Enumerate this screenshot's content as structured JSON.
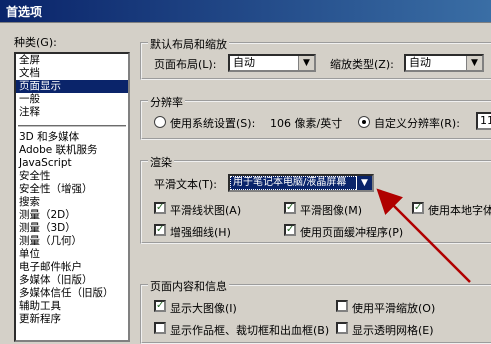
{
  "window": {
    "title": "首选项"
  },
  "categories": {
    "label": "种类(G):",
    "items": [
      "全屏",
      "文档",
      "页面显示",
      "一般",
      "注释"
    ],
    "items2": [
      "3D 和多媒体",
      "Adobe 联机服务",
      "JavaScript",
      "安全性",
      "安全性（增强）",
      "搜索",
      "测量（2D）",
      "测量（3D）",
      "测量（几何）",
      "单位",
      "电子邮件帐户",
      "多媒体（旧版）",
      "多媒体信任（旧版）",
      "辅助工具",
      "更新程序"
    ],
    "selected": "页面显示"
  },
  "default_layout": {
    "legend": "默认布局和缩放",
    "layout_label": "页面布局(L):",
    "layout_value": "自动",
    "zoom_label": "缩放类型(Z):",
    "zoom_value": "自动"
  },
  "resolution": {
    "legend": "分辨率",
    "system_label": "使用系统设置(S):",
    "system_value": "106 像素/英寸",
    "custom_label": "自定义分辨率(R):",
    "custom_value": "11"
  },
  "rendering": {
    "legend": "渲染",
    "smooth_label": "平滑文本(T):",
    "smooth_value": "用于笔记本电脑/液晶屏幕",
    "checks": [
      {
        "label": "平滑线状图(A)",
        "checked": true
      },
      {
        "label": "平滑图像(M)",
        "checked": true
      },
      {
        "label": "使用本地字体(L)",
        "checked": true
      },
      {
        "label": "增强细线(H)",
        "checked": true
      },
      {
        "label": "使用页面缓冲程序(P)",
        "checked": true
      }
    ]
  },
  "page_content": {
    "legend": "页面内容和信息",
    "checks": [
      {
        "label": "显示大图像(I)",
        "checked": true
      },
      {
        "label": "使用平滑缩放(O)",
        "checked": false
      },
      {
        "label": "显示作品框、裁切框和出血框(B)",
        "checked": false
      },
      {
        "label": "显示透明网格(E)",
        "checked": false
      }
    ]
  },
  "colors": {
    "selection": "#0a246a",
    "annotation_arrow": "#b00000",
    "dialog_bg": "#d4d0c8"
  }
}
